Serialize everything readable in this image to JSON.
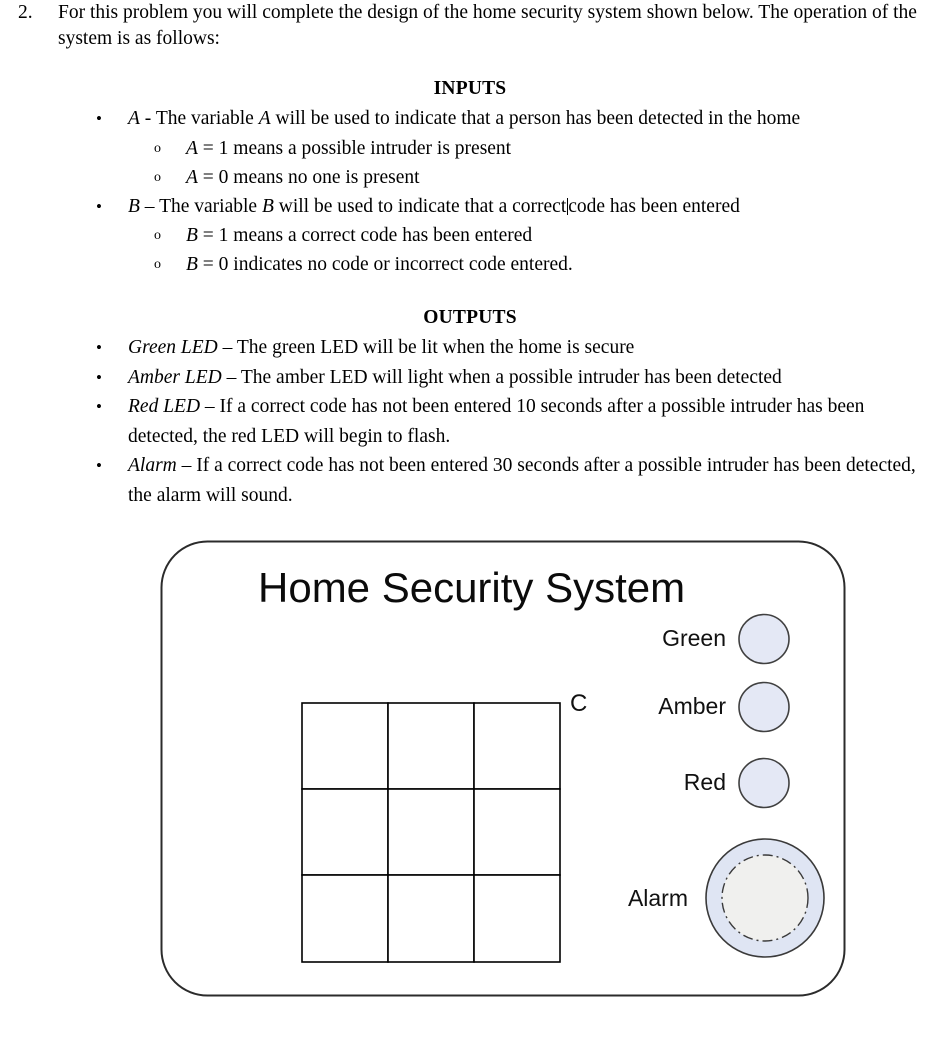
{
  "question": {
    "number": "2.",
    "text": "For this problem you will complete the design of the home security system shown below. The operation of the system is as follows:"
  },
  "inputs_section": {
    "heading": "INPUTS",
    "items": [
      {
        "bullet": "•",
        "lead": "A",
        "text": " - The variable ",
        "var2": "A",
        "text2": " will be used to indicate that a person has been detected in the home",
        "subitems": [
          {
            "obullet": "o",
            "var": "A",
            "text": " = 1 means a possible intruder is present"
          },
          {
            "obullet": "o",
            "var": "A",
            "text": " = 0 means no one is present"
          }
        ]
      },
      {
        "bullet": "•",
        "lead": "B",
        "text": " – The variable ",
        "var2": "B",
        "text2": " will be used to indicate that a correct",
        "text3": "code has been entered",
        "has_caret": true,
        "subitems": [
          {
            "obullet": "o",
            "var": "B",
            "text": " = 1 means a correct code has been entered"
          },
          {
            "obullet": "o",
            "var": "B",
            "text": " = 0 indicates no code or incorrect code entered."
          }
        ]
      }
    ]
  },
  "outputs_section": {
    "heading": "OUTPUTS",
    "items": [
      {
        "bullet": "•",
        "term": "Green LED",
        "text": " – The green LED will be lit when the home is secure"
      },
      {
        "bullet": "•",
        "term": "Amber LED",
        "text": " – The amber LED will light when a possible intruder has been detected"
      },
      {
        "bullet": "•",
        "term": "Red LED",
        "text": " – If a correct code has not been entered 10 seconds after a possible intruder has been detected, the red LED will begin to flash."
      },
      {
        "bullet": "•",
        "term": "Alarm",
        "text": " – If a correct code has not been entered 30 seconds after a possible intruder has been detected, the alarm will sound."
      }
    ]
  },
  "diagram": {
    "panel_title": "Home Security System",
    "keypad_label": "C",
    "keypad": {
      "rows": 3,
      "cols": 3,
      "cells": [
        "",
        "",
        "",
        "",
        "",
        "",
        "",
        "",
        ""
      ]
    },
    "indicators": [
      {
        "label": "Green",
        "fill": "#e4e8f5",
        "stroke": "#404040"
      },
      {
        "label": "Amber",
        "fill": "#e4e8f5",
        "stroke": "#404040"
      },
      {
        "label": "Red",
        "fill": "#e4e8f5",
        "stroke": "#404040"
      }
    ],
    "alarm": {
      "label": "Alarm",
      "outer_fill": "#dfe5f3",
      "inner_fill": "#f0f0ee",
      "stroke": "#3a3a3a"
    },
    "panel_stroke": "#2b2b2b",
    "panel_fill": "#ffffff"
  }
}
